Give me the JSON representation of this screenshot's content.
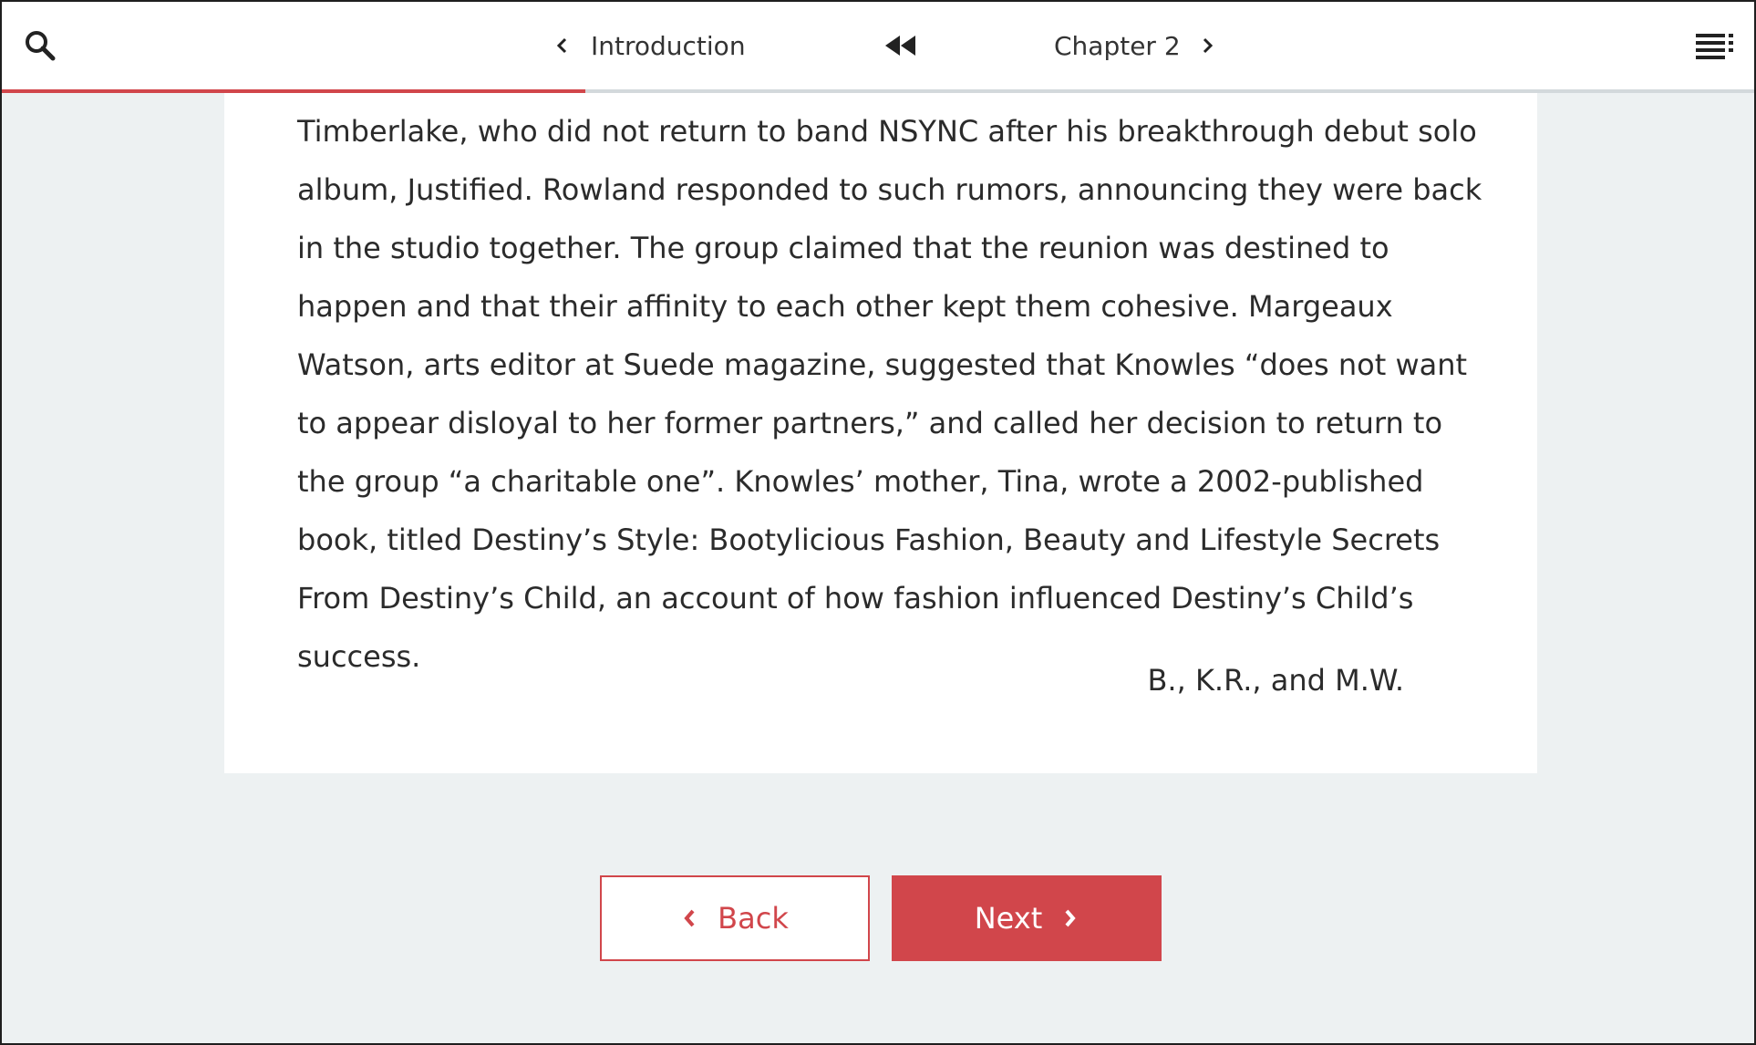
{
  "header": {
    "prev_label": "Introduction",
    "next_label": "Chapter 2",
    "progress_fraction": 0.333
  },
  "content": {
    "paragraph": "Timberlake, who did not return to band NSYNC after his breakthrough debut solo album, Justified. Rowland responded to such rumors, announcing they were back in the studio together. The group claimed that the reunion was destined to happen and that their affinity to each other kept them cohesive. Margeaux Watson, arts editor at Suede magazine, suggested that Knowles “does not want to appear disloyal to her former partners,” and called her decision to return to the group “a charitable one”. Knowles’ mother, Tina, wrote a 2002-published book, titled Destiny’s Style: Bootylicious Fashion, Beauty and Lifestyle Secrets From Destiny’s Child, an account of how fashion influenced Destiny’s Child’s success.",
    "signature": "B., K.R., and M.W."
  },
  "footer": {
    "back_label": "Back",
    "next_label": "Next"
  },
  "colors": {
    "accent": "#d1464b",
    "background": "#edf1f2",
    "page": "#ffffff",
    "text": "#2b2b2b"
  },
  "icons": {
    "search": "search-icon",
    "prev": "chevron-left-icon",
    "rewind": "rewind-icon",
    "next": "chevron-right-icon",
    "toc": "table-of-contents-icon"
  }
}
